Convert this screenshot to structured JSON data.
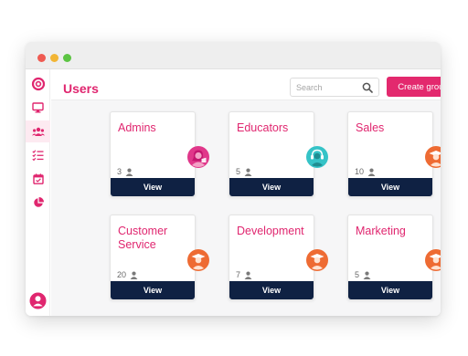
{
  "header": {
    "title": "Users",
    "search_placeholder": "Search",
    "create_label": "Create group"
  },
  "sidebar": {
    "items": [
      {
        "icon": "logo-icon"
      },
      {
        "icon": "monitor-icon"
      },
      {
        "icon": "users-icon",
        "active": true
      },
      {
        "icon": "checklist-icon"
      },
      {
        "icon": "calendar-icon"
      },
      {
        "icon": "pie-chart-icon"
      },
      {
        "icon": "profile-icon"
      }
    ]
  },
  "groups": [
    {
      "name": "Admins",
      "count": "3",
      "view_label": "View",
      "avatar": "pink-avatar-icon"
    },
    {
      "name": "Educators",
      "count": "5",
      "view_label": "View",
      "avatar": "teal-avatar-icon"
    },
    {
      "name": "Sales",
      "count": "10",
      "view_label": "View",
      "avatar": "graduate-avatar-icon"
    },
    {
      "name": "Customer Service",
      "count": "20",
      "view_label": "View",
      "avatar": "graduate-avatar-icon"
    },
    {
      "name": "Development",
      "count": "7",
      "view_label": "View",
      "avatar": "graduate-avatar-icon"
    },
    {
      "name": "Marketing",
      "count": "5",
      "view_label": "View",
      "avatar": "graduate-avatar-icon"
    }
  ],
  "colors": {
    "accent": "#e3296e",
    "view_button": "#0f2143",
    "graduate_avatar": "#ee6b33",
    "teal_avatar": "#35c3c7"
  }
}
